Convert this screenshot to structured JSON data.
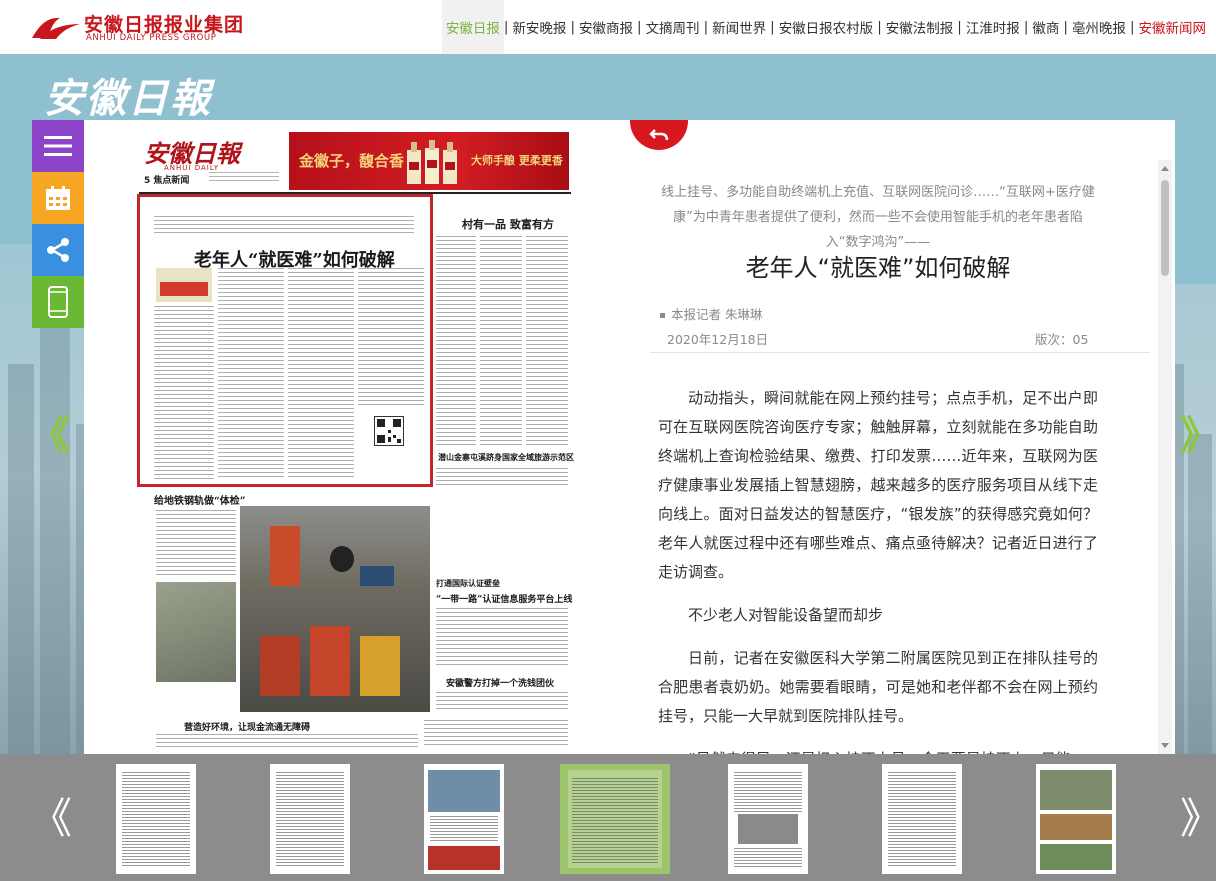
{
  "header": {
    "brand_cn": "安徽日报报业集团",
    "brand_en": "ANHUI DAILY PRESS GROUP",
    "nav": [
      {
        "label": "安徽日报",
        "active": true
      },
      {
        "label": "新安晚报"
      },
      {
        "label": "安徽商报"
      },
      {
        "label": "文摘周刊"
      },
      {
        "label": "新闻世界"
      },
      {
        "label": "安徽日报农村版"
      },
      {
        "label": "安徽法制报"
      },
      {
        "label": "江淮时报"
      },
      {
        "label": "徽商"
      },
      {
        "label": "亳州晚报"
      },
      {
        "label": "安徽新闻网",
        "highlight": true
      }
    ]
  },
  "masthead": "安徽日報",
  "sidebar": {
    "tools": [
      {
        "name": "menu-icon"
      },
      {
        "name": "calendar-icon"
      },
      {
        "name": "share-icon"
      },
      {
        "name": "mobile-icon"
      }
    ]
  },
  "nav_arrows": {
    "prev": "《",
    "next": "》"
  },
  "newspaper": {
    "logo": "安徽日報",
    "logo_en": "ANHUI DAILY",
    "section": "5 焦点新闻",
    "ad_slogan": "金徽子，馥合香",
    "ad_tagline": "大师手酿 更柔更香",
    "lead_headline": "老年人“就医难”如何破解",
    "headline_2": "村有一品 致富有方",
    "headline_3": "给地铁钢轨做“体检”",
    "headline_4": "“一带一路”认证信息服务平台上线",
    "headline_5": "安徽警方打掉一个洗钱团伙",
    "headline_6": "营造好环境，让现金流通无障碍",
    "headline_7": "潜山金寨屯溪跻身国家全域旅游示范区"
  },
  "article": {
    "lead": "线上挂号、多功能自助终端机上充值、互联网医院问诊……“互联网+医疗健康”为中青年患者提供了便利，然而一些不会使用智能手机的老年患者陷入“数字鸿沟”——",
    "title": "老年人“就医难”如何破解",
    "byline": "本报记者 朱琳琳",
    "date": "2020年12月18日",
    "page": "版次：05",
    "paragraphs": [
      "动动指头，瞬间就能在网上预约挂号；点点手机，足不出户即可在互联网医院咨询医疗专家；触触屏幕，立刻就能在多功能自助终端机上查询检验结果、缴费、打印发票……近年来，互联网为医疗健康事业发展插上智慧翅膀，越来越多的医疗服务项目从线下走向线上。面对日益发达的智慧医疗，“银发族”的获得感究竟如何？老年人就医过程中还有哪些难点、痛点亟待解决？记者近日进行了走访调查。",
      "不少老人对智能设备望而却步",
      "日前，记者在安徽医科大学第二附属医院见到正在排队挂号的合肥患者袁奶奶。她需要看眼睛，可是她和老伴都不会在网上预约挂号，只能一大早就到医院排队挂号。",
      "“虽然来得早，还是担心挂不上号。今天要是挂不上，只能"
    ]
  },
  "thumbnails": {
    "prev": "《",
    "next": "》",
    "pages": [
      {
        "active": false
      },
      {
        "active": false
      },
      {
        "active": false
      },
      {
        "active": true
      },
      {
        "active": false
      },
      {
        "active": false
      },
      {
        "active": false
      }
    ]
  }
}
